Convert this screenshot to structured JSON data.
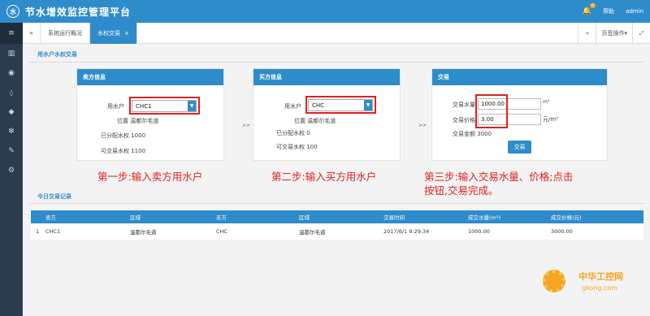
{
  "header": {
    "logo_glyph": "水",
    "title": "节水增效监控管理平台",
    "notification_count": "0",
    "help": "帮助",
    "user": "admin"
  },
  "sidebar": {
    "items": [
      {
        "icon": "menu-icon",
        "glyph": "≡"
      },
      {
        "icon": "chart-icon",
        "glyph": "▥"
      },
      {
        "icon": "location-icon",
        "glyph": "◉"
      },
      {
        "icon": "water-drop-icon",
        "glyph": "💧"
      },
      {
        "icon": "water-drop-alt-icon",
        "glyph": "◆"
      },
      {
        "icon": "irrigation-icon",
        "glyph": "✻"
      },
      {
        "icon": "wrench-icon",
        "glyph": "✎"
      },
      {
        "icon": "settings-icon",
        "glyph": "⚙"
      }
    ]
  },
  "tabs": {
    "back_glyph": "«",
    "items": [
      {
        "label": "系统运行概况",
        "active": false
      },
      {
        "label": "水权交易",
        "active": true
      }
    ],
    "close_glyph": "×",
    "forward_glyph": "»",
    "page_ops": "页签操作▾",
    "fullscreen_glyph": "⤢"
  },
  "main": {
    "section_title": "用水户水权交易",
    "seller": {
      "heading": "卖方信息",
      "user_label": "用水户",
      "user_value": "CHC1",
      "location": "位置 温都尔毛道",
      "allocated": "已分配水权 1000",
      "tradable": "可交易水权 1100"
    },
    "buyer": {
      "heading": "买方信息",
      "user_label": "用水户",
      "user_value": "CHC",
      "location": "位置 温都尔毛道",
      "allocated": "已分配水权 0",
      "tradable": "可交易水权 100"
    },
    "trade": {
      "heading": "交易",
      "qty_label": "交易水量",
      "qty_value": "1000.00",
      "qty_unit": "m³",
      "price_label": "交易价格",
      "price_value": "3.00",
      "price_unit": "元/m³",
      "amount": "交易金额 3000",
      "button": "交易"
    },
    "separator": ">>",
    "steps": {
      "step1": "第一步:输入卖方用水户",
      "step2": "第二步:输入买方用水户",
      "step3_line1": "第三步:输入交易水量、价格;点击",
      "step3_line2": "按钮,交易完成。"
    },
    "records_title": "今日交易记录",
    "table": {
      "columns": [
        "卖方",
        "区域",
        "买方",
        "区域",
        "交易时间",
        "成交水量(m³)",
        "成交价格(元)"
      ],
      "rows": [
        [
          "1",
          "CHC1",
          "温都尔毛道",
          "CHC",
          "温都尔毛道",
          "2017/6/1 9:29:34",
          "1000.00",
          "3000.00"
        ]
      ]
    }
  },
  "watermark": {
    "cn": "中华工控网",
    "en": "gkong.com"
  },
  "colors": {
    "primary": "#2f8ccb",
    "sidebar": "#2b3c4e",
    "annotation": "#e02020",
    "background": "#f3f3f4"
  }
}
